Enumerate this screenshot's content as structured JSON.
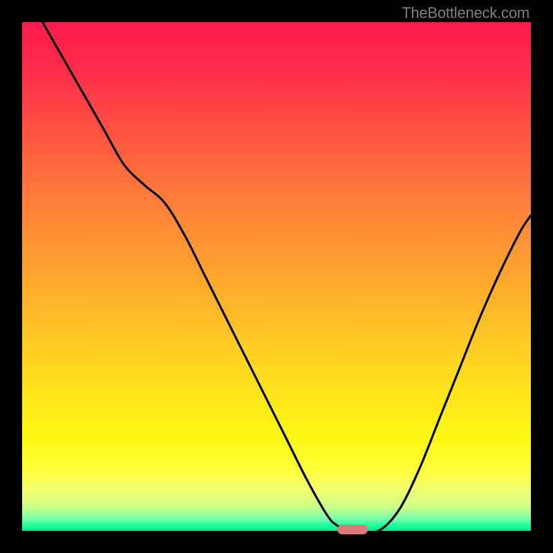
{
  "watermark": "TheBottleneck.com",
  "colors": {
    "curve": "#000000",
    "marker": "#da7b7b",
    "background_black": "#000000"
  },
  "chart_data": {
    "type": "line",
    "title": "",
    "xlabel": "",
    "ylabel": "",
    "xlim": [
      0,
      100
    ],
    "ylim": [
      0,
      100
    ],
    "x": [
      4,
      8,
      12,
      16,
      20,
      24,
      28,
      32,
      36,
      40,
      44,
      48,
      52,
      56,
      60,
      62,
      64,
      66,
      70,
      74,
      78,
      82,
      86,
      90,
      94,
      98,
      100
    ],
    "y": [
      100,
      93,
      86,
      79,
      72,
      68,
      64.5,
      58,
      50,
      42,
      34,
      26,
      18,
      10,
      3,
      1,
      0,
      0,
      0,
      4,
      12,
      22,
      32,
      42,
      51,
      59,
      62
    ],
    "optimal_range_x": [
      62,
      68
    ],
    "marker_y": 0
  }
}
